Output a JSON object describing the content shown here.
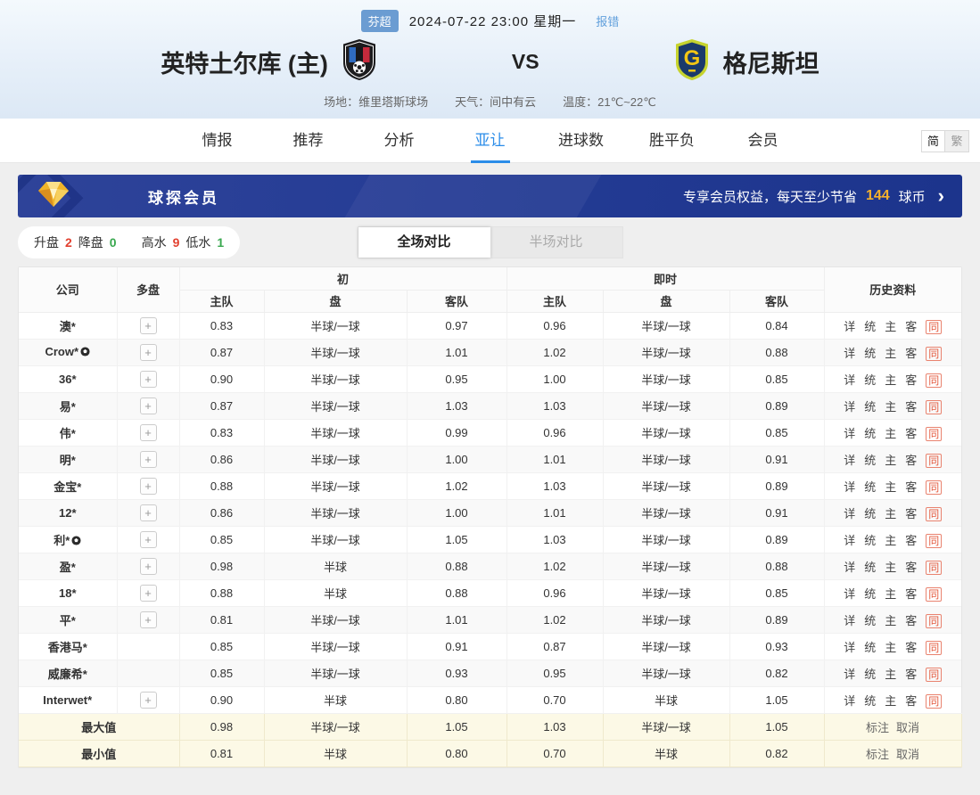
{
  "header": {
    "league_badge": "芬超",
    "datetime": "2024-07-22 23:00 星期一",
    "report_link": "报错",
    "home_team": "英特土尔库 (主)",
    "vs": "VS",
    "away_team": "格尼斯坦",
    "away_logo_letter": "G",
    "venue_label": "场地：维里塔斯球场",
    "weather_label": "天气：间中有云",
    "temp_label": "温度：21℃~22℃"
  },
  "nav": {
    "tabs": [
      {
        "label": "情报",
        "active": false
      },
      {
        "label": "推荐",
        "active": false
      },
      {
        "label": "分析",
        "active": false
      },
      {
        "label": "亚让",
        "active": true
      },
      {
        "label": "进球数",
        "active": false
      },
      {
        "label": "胜平负",
        "active": false
      },
      {
        "label": "会员",
        "active": false
      }
    ],
    "lang_simplified": "简",
    "lang_traditional": "繁"
  },
  "banner": {
    "title": "球探会员",
    "promo_prefix": "专享会员权益，每天至少节省",
    "promo_value": "144",
    "promo_suffix": "球币",
    "arrow": "›"
  },
  "filters": {
    "rise_label": "升盘",
    "rise_value": "2",
    "drop_label": "降盘",
    "drop_value": "0",
    "high_label": "高水",
    "high_value": "9",
    "low_label": "低水",
    "low_value": "1",
    "full_toggle": "全场对比",
    "half_toggle": "半场对比"
  },
  "table": {
    "headers": {
      "company": "公司",
      "multi": "多盘",
      "initial": "初",
      "live": "即时",
      "home": "主队",
      "handicap": "盘",
      "away": "客队",
      "history": "历史资料"
    },
    "plus_label": "+",
    "history_links": [
      "详",
      "统",
      "主",
      "客",
      "同"
    ],
    "rows": [
      {
        "company": "澳*",
        "ball": false,
        "multi": true,
        "init": [
          "0.83",
          "半球/一球",
          "0.97"
        ],
        "live": [
          "0.96",
          "半球/一球",
          "0.84"
        ]
      },
      {
        "company": "Crow*",
        "ball": true,
        "multi": true,
        "init": [
          "0.87",
          "半球/一球",
          "1.01"
        ],
        "live": [
          "1.02",
          "半球/一球",
          "0.88"
        ]
      },
      {
        "company": "36*",
        "ball": false,
        "multi": true,
        "init": [
          "0.90",
          "半球/一球",
          "0.95"
        ],
        "live": [
          "1.00",
          "半球/一球",
          "0.85"
        ]
      },
      {
        "company": "易*",
        "ball": false,
        "multi": true,
        "init": [
          "0.87",
          "半球/一球",
          "1.03"
        ],
        "live": [
          "1.03",
          "半球/一球",
          "0.89"
        ]
      },
      {
        "company": "伟*",
        "ball": false,
        "multi": true,
        "init": [
          "0.83",
          "半球/一球",
          "0.99"
        ],
        "live": [
          "0.96",
          "半球/一球",
          "0.85"
        ]
      },
      {
        "company": "明*",
        "ball": false,
        "multi": true,
        "init": [
          "0.86",
          "半球/一球",
          "1.00"
        ],
        "live": [
          "1.01",
          "半球/一球",
          "0.91"
        ]
      },
      {
        "company": "金宝*",
        "ball": false,
        "multi": true,
        "init": [
          "0.88",
          "半球/一球",
          "1.02"
        ],
        "live": [
          "1.03",
          "半球/一球",
          "0.89"
        ]
      },
      {
        "company": "12*",
        "ball": false,
        "multi": true,
        "init": [
          "0.86",
          "半球/一球",
          "1.00"
        ],
        "live": [
          "1.01",
          "半球/一球",
          "0.91"
        ]
      },
      {
        "company": "利*",
        "ball": true,
        "multi": true,
        "init": [
          "0.85",
          "半球/一球",
          "1.05"
        ],
        "live": [
          "1.03",
          "半球/一球",
          "0.89"
        ]
      },
      {
        "company": "盈*",
        "ball": false,
        "multi": true,
        "init": [
          "0.98",
          "半球",
          "0.88"
        ],
        "live": [
          "1.02",
          "半球/一球",
          "0.88"
        ]
      },
      {
        "company": "18*",
        "ball": false,
        "multi": true,
        "init": [
          "0.88",
          "半球",
          "0.88"
        ],
        "live": [
          "0.96",
          "半球/一球",
          "0.85"
        ]
      },
      {
        "company": "平*",
        "ball": false,
        "multi": true,
        "init": [
          "0.81",
          "半球/一球",
          "1.01"
        ],
        "live": [
          "1.02",
          "半球/一球",
          "0.89"
        ]
      },
      {
        "company": "香港马*",
        "ball": false,
        "multi": false,
        "init": [
          "0.85",
          "半球/一球",
          "0.91"
        ],
        "live": [
          "0.87",
          "半球/一球",
          "0.93"
        ]
      },
      {
        "company": "威廉希*",
        "ball": false,
        "multi": false,
        "init": [
          "0.85",
          "半球/一球",
          "0.93"
        ],
        "live": [
          "0.95",
          "半球/一球",
          "0.82"
        ]
      },
      {
        "company": "Interwet*",
        "ball": false,
        "multi": true,
        "init": [
          "0.90",
          "半球",
          "0.80"
        ],
        "live": [
          "0.70",
          "半球",
          "1.05"
        ]
      }
    ],
    "summary_rows": [
      {
        "label": "最大值",
        "init": [
          "0.98",
          "半球/一球",
          "1.05"
        ],
        "live": [
          "1.03",
          "半球/一球",
          "1.05"
        ],
        "actions": [
          "标注",
          "取消"
        ]
      },
      {
        "label": "最小值",
        "init": [
          "0.81",
          "半球",
          "0.80"
        ],
        "live": [
          "0.70",
          "半球",
          "0.82"
        ],
        "actions": [
          "标注",
          "取消"
        ]
      }
    ]
  },
  "colors": {
    "accent_blue": "#2a8ce8",
    "banner_blue": "#253c95",
    "gold": "#f5b02c",
    "rise_red": "#e2402f",
    "drop_green": "#39a84f",
    "same_link_red": "#e4593d"
  }
}
